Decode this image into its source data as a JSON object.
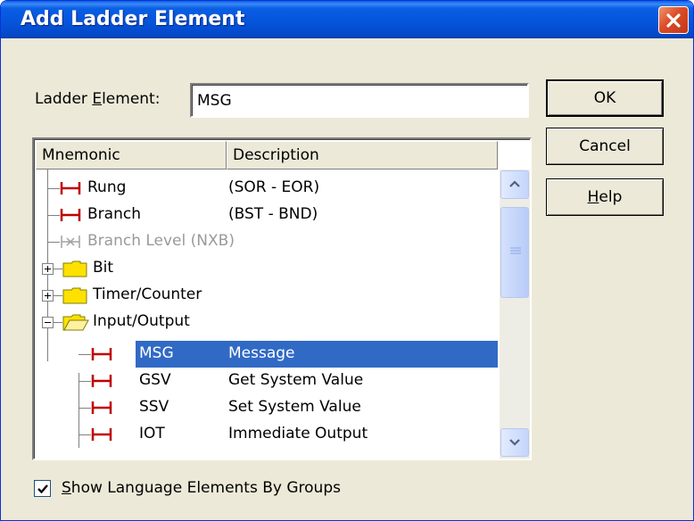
{
  "window": {
    "title": "Add Ladder Element"
  },
  "icons": {
    "close": "close-icon",
    "rung": "rung-icon",
    "folder": "folder-icon",
    "folder_open": "open-folder-icon",
    "expand": "plus-box-icon",
    "collapse": "minus-box-icon",
    "scroll_up": "scroll-up-icon",
    "scroll_down": "scroll-down-icon"
  },
  "colors": {
    "titlebar": "#0553d9",
    "selection": "#316ac5",
    "close": "#dc4c26",
    "instruction_icon": "#c00000"
  },
  "form": {
    "label_pre": "Ladder ",
    "label_access": "E",
    "label_post": "lement:",
    "value": "MSG"
  },
  "buttons": {
    "ok": "OK",
    "cancel": "Cancel",
    "help_access": "H",
    "help_rest": "elp"
  },
  "list": {
    "columns": [
      "Mnemonic",
      "Description"
    ],
    "items": [
      {
        "mnemonic": "Rung",
        "description": "(SOR - EOR)"
      },
      {
        "mnemonic": "Branch",
        "description": "(BST - BND)"
      },
      {
        "mnemonic": "Branch Level",
        "description": "(NXB)"
      },
      {
        "mnemonic": "Bit",
        "description": ""
      },
      {
        "mnemonic": "Timer/Counter",
        "description": ""
      },
      {
        "mnemonic": "Input/Output",
        "description": ""
      },
      {
        "mnemonic": "MSG",
        "description": "Message"
      },
      {
        "mnemonic": "GSV",
        "description": "Get System Value"
      },
      {
        "mnemonic": "SSV",
        "description": "Set System Value"
      },
      {
        "mnemonic": "IOT",
        "description": "Immediate Output"
      }
    ]
  },
  "checkbox": {
    "label_access": "S",
    "label_rest": "how Language Elements By Groups",
    "checked": true
  }
}
